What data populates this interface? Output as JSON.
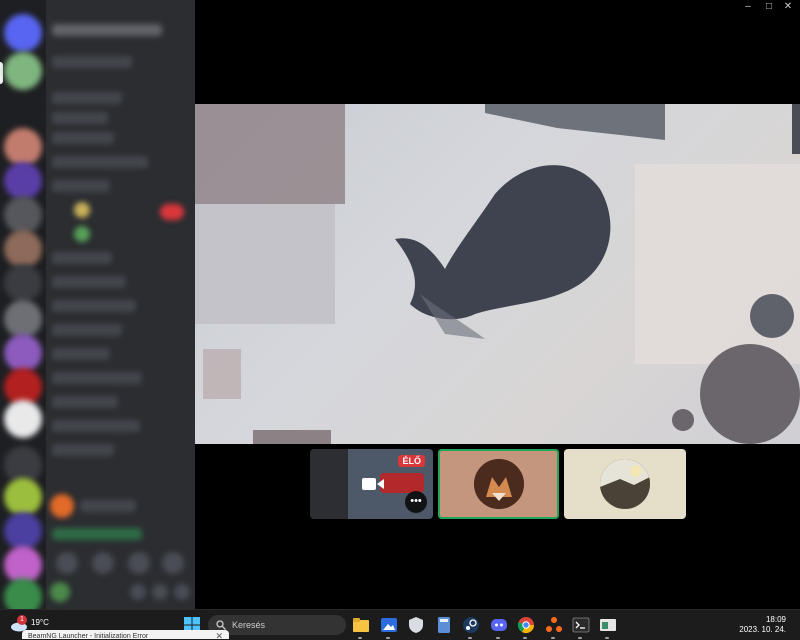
{
  "window": {
    "controls": [
      "minimize",
      "maximize",
      "close"
    ]
  },
  "thumbnails": [
    {
      "name": "screen-share",
      "live_label": "ÉLŐ"
    },
    {
      "name": "participant-fox",
      "active": true
    },
    {
      "name": "participant-landscape",
      "active": false
    }
  ],
  "taskbar": {
    "weather": {
      "temp": "19°C",
      "badge": "1"
    },
    "search_placeholder": "Keresés",
    "clock": {
      "time": "18:09",
      "date": "2023. 10. 24."
    },
    "apps": [
      "file-explorer",
      "photos",
      "security",
      "calculator",
      "steam",
      "discord",
      "chrome",
      "app-orange",
      "terminal",
      "app-window"
    ]
  },
  "notification": {
    "text": "BeamNG Launcher - Initialization Error"
  },
  "colors": {
    "accent_green": "#23a55a",
    "live_red": "#da373c",
    "taskbar": "#1c1c1c",
    "sidebar": "#2b2d31"
  }
}
